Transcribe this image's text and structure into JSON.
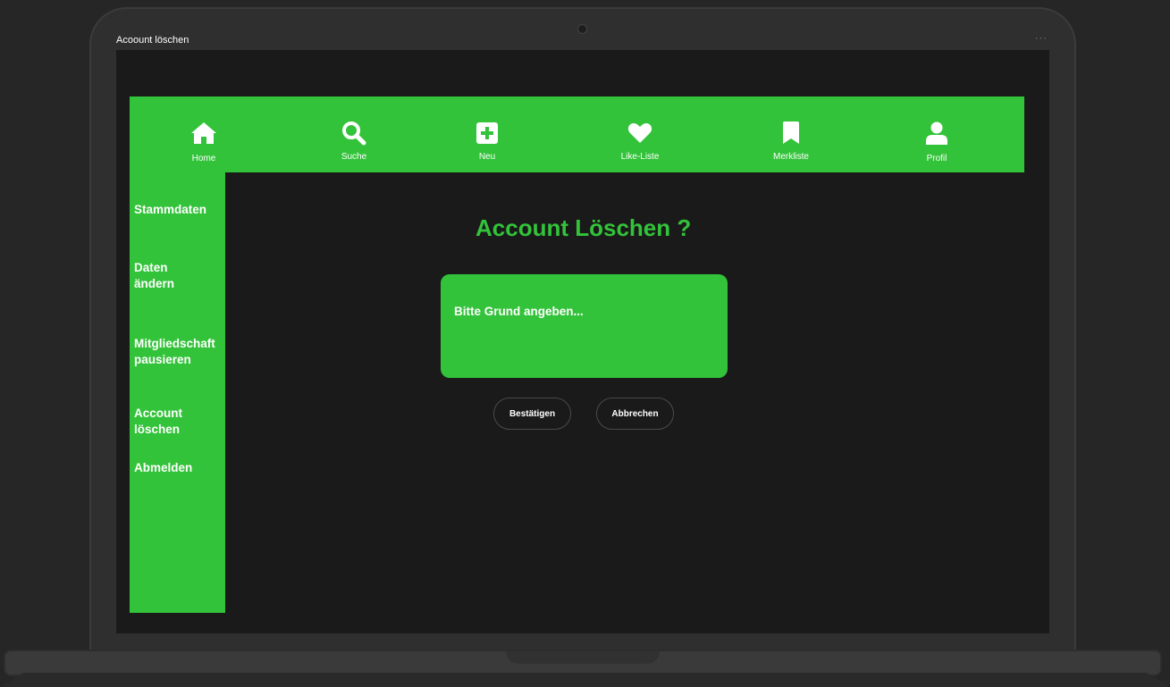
{
  "window": {
    "title": "Acoount löschen",
    "menu_dots": "···"
  },
  "colors": {
    "accent": "#33c33a",
    "screen_bg": "#1a1a1a",
    "text": "#ffffff"
  },
  "nav": {
    "items": [
      {
        "label": "Home",
        "icon": "home-icon"
      },
      {
        "label": "Suche",
        "icon": "search-icon"
      },
      {
        "label": "Neu",
        "icon": "plus-square-icon"
      },
      {
        "label": "Like-Liste",
        "icon": "heart-icon"
      },
      {
        "label": "Merkliste",
        "icon": "bookmark-icon"
      },
      {
        "label": "Profil",
        "icon": "user-icon"
      }
    ]
  },
  "sidebar": {
    "items": [
      {
        "label": "Stammdaten"
      },
      {
        "label": "Daten ändern"
      },
      {
        "label": "Mitgliedschaft pausieren"
      },
      {
        "label": "Account löschen"
      },
      {
        "label": "Abmelden"
      }
    ]
  },
  "main": {
    "heading": "Account Löschen ?",
    "reason_placeholder": "Bitte Grund angeben...",
    "confirm_label": "Bestätigen",
    "cancel_label": "Abbrechen"
  }
}
